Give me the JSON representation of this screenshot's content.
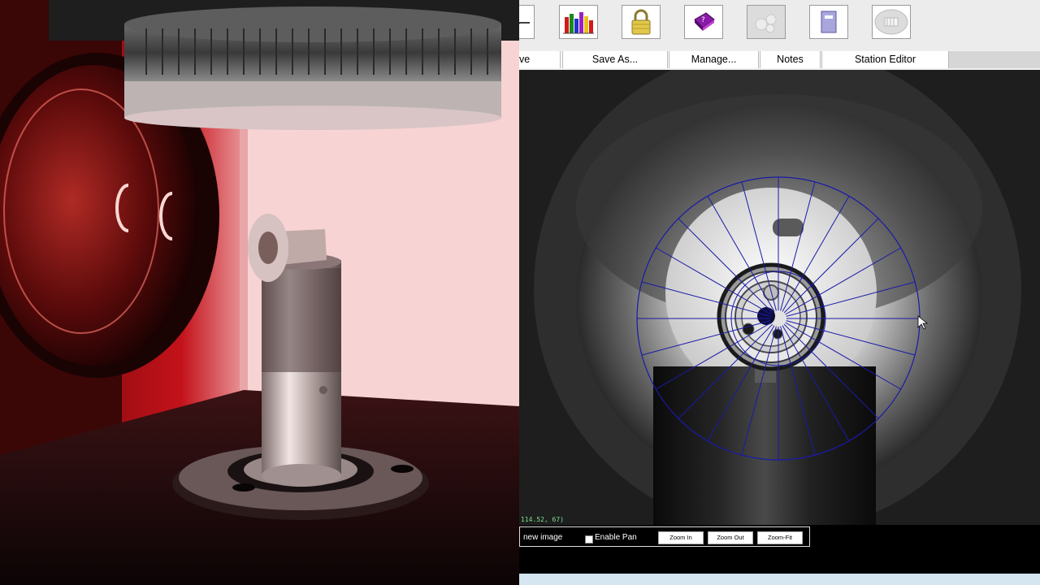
{
  "toolbar": {
    "buttons": [
      {
        "name": "waveform-icon"
      },
      {
        "name": "bar-chart-icon"
      },
      {
        "name": "padlock-icon"
      },
      {
        "name": "help-book-icon"
      },
      {
        "name": "gear-cluster-icon"
      },
      {
        "name": "notebook-icon"
      },
      {
        "name": "network-disk-icon"
      }
    ]
  },
  "menu": {
    "save_partial": "ve",
    "save_as": "Save As...",
    "manage": "Manage...",
    "notes": "Notes",
    "station_editor": "Station Editor"
  },
  "viewer": {
    "coordinates": "114.52, 67)",
    "overlay_color": "#1a1aa8"
  },
  "controls": {
    "new_image": "new image",
    "enable_pan": "Enable Pan",
    "zoom_in": "Zoom In",
    "zoom_out": "Zoom Out",
    "zoom_fit": "Zoom-Fit"
  }
}
